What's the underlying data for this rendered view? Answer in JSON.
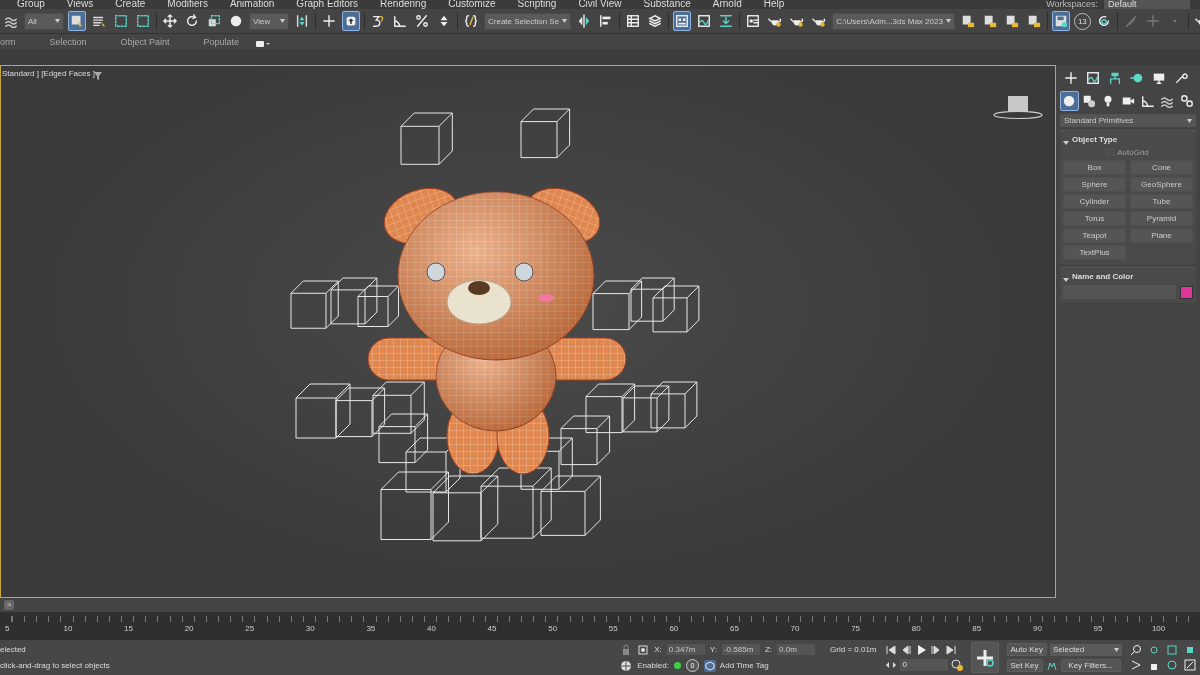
{
  "menu_bar": {
    "items": [
      "Group",
      "Views",
      "Create",
      "Modifiers",
      "Animation",
      "Graph Editors",
      "Rendering",
      "Customize",
      "Scripting",
      "Civil View",
      "Substance",
      "Arnold",
      "Help"
    ],
    "workspaces_label": "Workspaces:",
    "workspace": "Default"
  },
  "main_toolbar": {
    "items": [
      {
        "kind": "wave",
        "selected": false
      },
      {
        "kind": "dropdown",
        "value": "All"
      },
      {
        "kind": "cursor",
        "selected": true
      },
      {
        "kind": "list",
        "selected": false
      },
      {
        "kind": "dashsquare",
        "selected": false
      },
      {
        "kind": "dashsquare",
        "selected": false
      },
      {
        "kind": "sep"
      },
      {
        "kind": "move",
        "selected": false
      },
      {
        "kind": "rotate",
        "selected": false
      },
      {
        "kind": "scale",
        "selected": false
      },
      {
        "kind": "sphere",
        "selected": false
      },
      {
        "kind": "dropdown",
        "value": "View"
      },
      {
        "kind": "pivot",
        "selected": false
      },
      {
        "kind": "sep"
      },
      {
        "kind": "crosshair",
        "selected": false
      },
      {
        "kind": "arrowup",
        "selected": true
      },
      {
        "kind": "sep"
      },
      {
        "kind": "snap",
        "selected": false
      },
      {
        "kind": "angle",
        "selected": false
      },
      {
        "kind": "percent",
        "selected": false
      },
      {
        "kind": "spinner",
        "selected": false
      },
      {
        "kind": "sep"
      },
      {
        "kind": "braces",
        "selected": false
      },
      {
        "kind": "dropdown",
        "value": "Create Selection Se"
      },
      {
        "kind": "mirror",
        "selected": false
      },
      {
        "kind": "align",
        "selected": false
      },
      {
        "kind": "sep"
      },
      {
        "kind": "table",
        "selected": false
      },
      {
        "kind": "layers",
        "selected": false
      },
      {
        "kind": "sep"
      },
      {
        "kind": "panels",
        "selected": true
      },
      {
        "kind": "curve",
        "selected": false
      },
      {
        "kind": "download",
        "selected": false
      },
      {
        "kind": "sep"
      },
      {
        "kind": "gridwin",
        "selected": false
      },
      {
        "kind": "teapot",
        "selected": false
      },
      {
        "kind": "teapot",
        "selected": false
      },
      {
        "kind": "teapot",
        "selected": false
      },
      {
        "kind": "dropdown",
        "value": "C:\\Users\\Adm...3ds Max 2023"
      },
      {
        "kind": "folder",
        "selected": false
      },
      {
        "kind": "folder",
        "selected": false
      },
      {
        "kind": "folder",
        "selected": false
      },
      {
        "kind": "folder",
        "selected": false
      },
      {
        "kind": "sep"
      },
      {
        "kind": "save",
        "selected": true
      },
      {
        "kind": "badge",
        "value": "13"
      },
      {
        "kind": "refresh",
        "selected": false
      },
      {
        "kind": "sep"
      },
      {
        "kind": "brush",
        "selected": false
      },
      {
        "kind": "plusdim",
        "selected": false
      },
      {
        "kind": "dot",
        "selected": false
      },
      {
        "kind": "sep"
      },
      {
        "kind": "teapot",
        "selected": false
      }
    ]
  },
  "ribbon_tabs": [
    "orm",
    "Selection",
    "Object Paint",
    "Populate"
  ],
  "viewport": {
    "label": "Standard ] [Edged Faces ]",
    "active": true
  },
  "command_panel": {
    "tabs": [
      {
        "kind": "plus",
        "selected": false
      },
      {
        "kind": "curve",
        "selected": false
      },
      {
        "kind": "hierarchy",
        "selected": false
      },
      {
        "kind": "motion",
        "selected": false
      },
      {
        "kind": "monitor",
        "selected": false
      },
      {
        "kind": "wrench",
        "selected": false
      }
    ],
    "categories": [
      {
        "kind": "sphere",
        "selected": true
      },
      {
        "kind": "shapes",
        "selected": false
      },
      {
        "kind": "bulb",
        "selected": false
      },
      {
        "kind": "camera",
        "selected": false
      },
      {
        "kind": "angle",
        "selected": false
      },
      {
        "kind": "wave",
        "selected": false
      },
      {
        "kind": "links",
        "selected": false
      }
    ],
    "type_dropdown": "Standard Primitives",
    "object_type": {
      "title": "Object Type",
      "expanded": true,
      "autogrid": {
        "label": "AutoGrid",
        "checked": false,
        "disabled": true
      },
      "buttons": [
        "Box",
        "Cone",
        "Sphere",
        "GeoSphere",
        "Cylinder",
        "Tube",
        "Torus",
        "Pyramid",
        "Teapot",
        "Plane",
        "TextPlus"
      ]
    },
    "name_and_color": {
      "title": "Name and Color",
      "expanded": true,
      "color": "#e0359a"
    }
  },
  "timeline": {
    "next_button": ">",
    "ticks": [
      "5",
      "10",
      "15",
      "20",
      "25",
      "30",
      "35",
      "40",
      "45",
      "50",
      "55",
      "60",
      "65",
      "70",
      "75",
      "80",
      "85",
      "90",
      "95",
      "100"
    ]
  },
  "status_bar": {
    "selection": "elected",
    "prompt": "click-and-drag to select objects",
    "x_label": "X:",
    "x": "0.347m",
    "y_label": "Y:",
    "y": "-0.585m",
    "z_label": "Z:",
    "z": "0.0m",
    "grid": "Grid = 0.01m",
    "enabled_label": "Enabled:",
    "time_tag_count": "0",
    "add_time_tag": "Add Time Tag",
    "frame": "0",
    "auto_key": "Auto Key",
    "key_mode": "Selected",
    "set_key": "Set Key",
    "key_filters": "Key Filters..."
  }
}
